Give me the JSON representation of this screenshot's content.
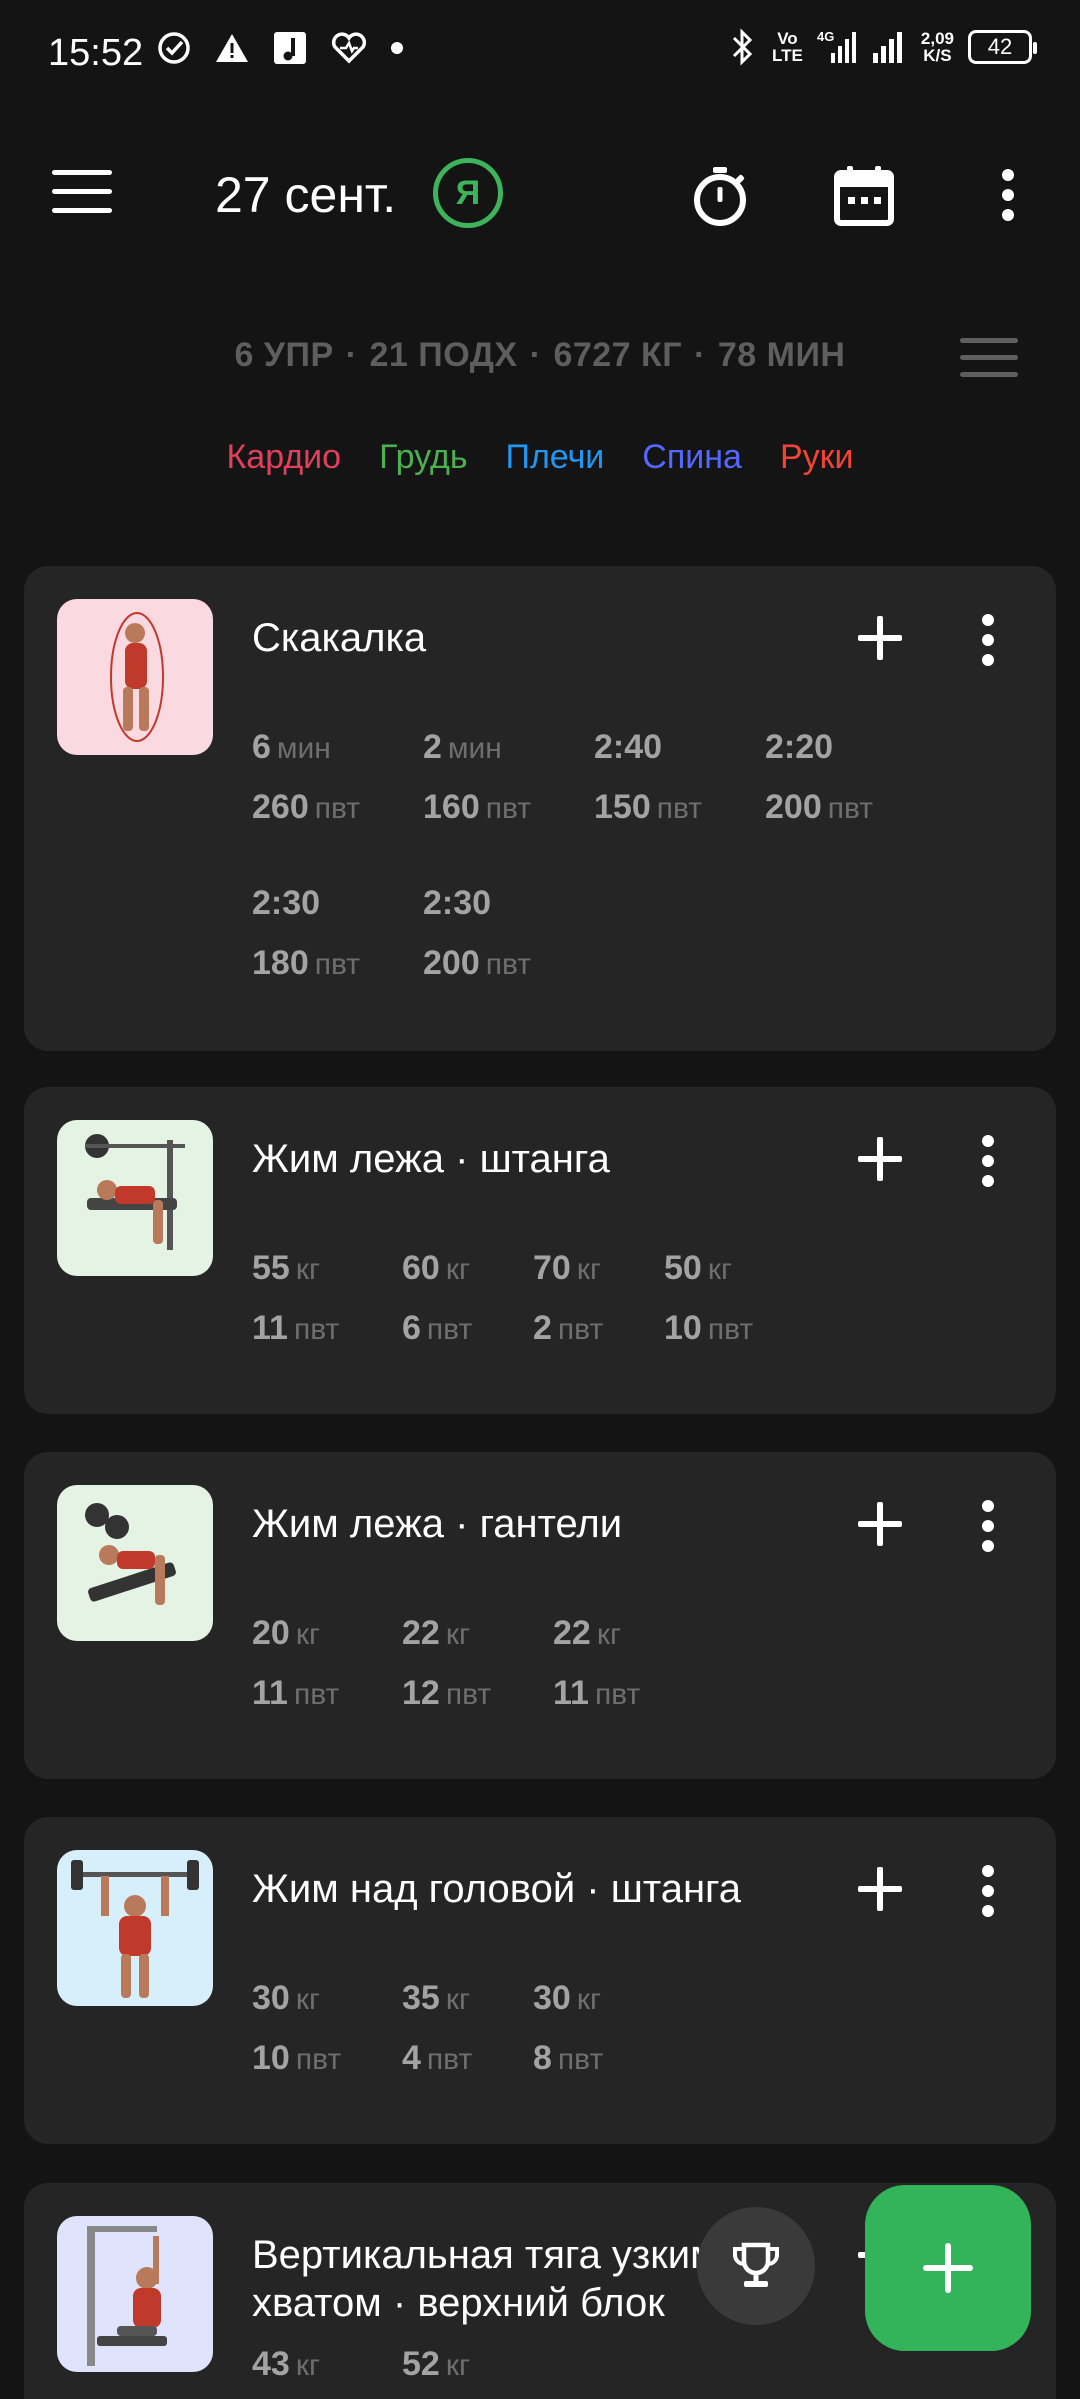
{
  "status_bar": {
    "time": "15:52",
    "network_type_top": "Vo",
    "network_type_bottom": "LTE",
    "data_speed_value": "2,09",
    "data_speed_unit": "K/S",
    "battery": "42",
    "left_icons": [
      "check-circle-icon",
      "warning-icon",
      "music-app-icon",
      "heart-icon",
      "dot-icon"
    ],
    "right_icons": [
      "bluetooth-icon",
      "signal-icon",
      "signal-icon"
    ]
  },
  "header": {
    "date": "27 сент.",
    "today_badge": "Я",
    "actions": [
      "timer-icon",
      "calendar-icon",
      "more-vertical-icon"
    ]
  },
  "summary": {
    "exercises": "6 УПР",
    "sets": "21 ПОДХ",
    "volume": "6727 КГ",
    "duration": "78 МИН",
    "separator": "·"
  },
  "muscle_groups": [
    {
      "label": "Кардио",
      "color": "#e0405e"
    },
    {
      "label": "Грудь",
      "color": "#4caf50"
    },
    {
      "label": "Плечи",
      "color": "#2196f3"
    },
    {
      "label": "Спина",
      "color": "#5468ff"
    },
    {
      "label": "Руки",
      "color": "#f44336"
    }
  ],
  "exercises": [
    {
      "name": "Скакалка",
      "thumb_color": "#fbd9e1",
      "sets": [
        {
          "v1": "6",
          "u1": "мин",
          "v2": "260",
          "u2": "пвт"
        },
        {
          "v1": "2",
          "u1": "мин",
          "v2": "160",
          "u2": "пвт"
        },
        {
          "v1": "2:40",
          "u1": "",
          "v2": "150",
          "u2": "пвт"
        },
        {
          "v1": "2:20",
          "u1": "",
          "v2": "200",
          "u2": "пвт"
        },
        {
          "v1": "2:30",
          "u1": "",
          "v2": "180",
          "u2": "пвт"
        },
        {
          "v1": "2:30",
          "u1": "",
          "v2": "200",
          "u2": "пвт"
        }
      ]
    },
    {
      "name": "Жим лежа · штанга",
      "thumb_color": "#e4f3e3",
      "sets": [
        {
          "v1": "55",
          "u1": "кг",
          "v2": "11",
          "u2": "пвт"
        },
        {
          "v1": "60",
          "u1": "кг",
          "v2": "6",
          "u2": "пвт"
        },
        {
          "v1": "70",
          "u1": "кг",
          "v2": "2",
          "u2": "пвт"
        },
        {
          "v1": "50",
          "u1": "кг",
          "v2": "10",
          "u2": "пвт"
        }
      ]
    },
    {
      "name": "Жим лежа · гантели",
      "thumb_color": "#e4f3e3",
      "sets": [
        {
          "v1": "20",
          "u1": "кг",
          "v2": "11",
          "u2": "пвт"
        },
        {
          "v1": "22",
          "u1": "кг",
          "v2": "12",
          "u2": "пвт"
        },
        {
          "v1": "22",
          "u1": "кг",
          "v2": "11",
          "u2": "пвт"
        }
      ]
    },
    {
      "name": "Жим над головой · штанга",
      "thumb_color": "#d7eefb",
      "sets": [
        {
          "v1": "30",
          "u1": "кг",
          "v2": "10",
          "u2": "пвт"
        },
        {
          "v1": "35",
          "u1": "кг",
          "v2": "4",
          "u2": "пвт"
        },
        {
          "v1": "30",
          "u1": "кг",
          "v2": "8",
          "u2": "пвт"
        }
      ]
    },
    {
      "name": "Вертикальная тяга узким хватом · верхний блок",
      "thumb_color": "#dfe3fb",
      "sets": [
        {
          "v1": "43",
          "u1": "кг",
          "v2": "",
          "u2": ""
        },
        {
          "v1": "52",
          "u1": "кг",
          "v2": "",
          "u2": ""
        }
      ]
    }
  ],
  "fabs": {
    "secondary_icon": "trophy-icon",
    "primary_icon": "plus-icon"
  }
}
